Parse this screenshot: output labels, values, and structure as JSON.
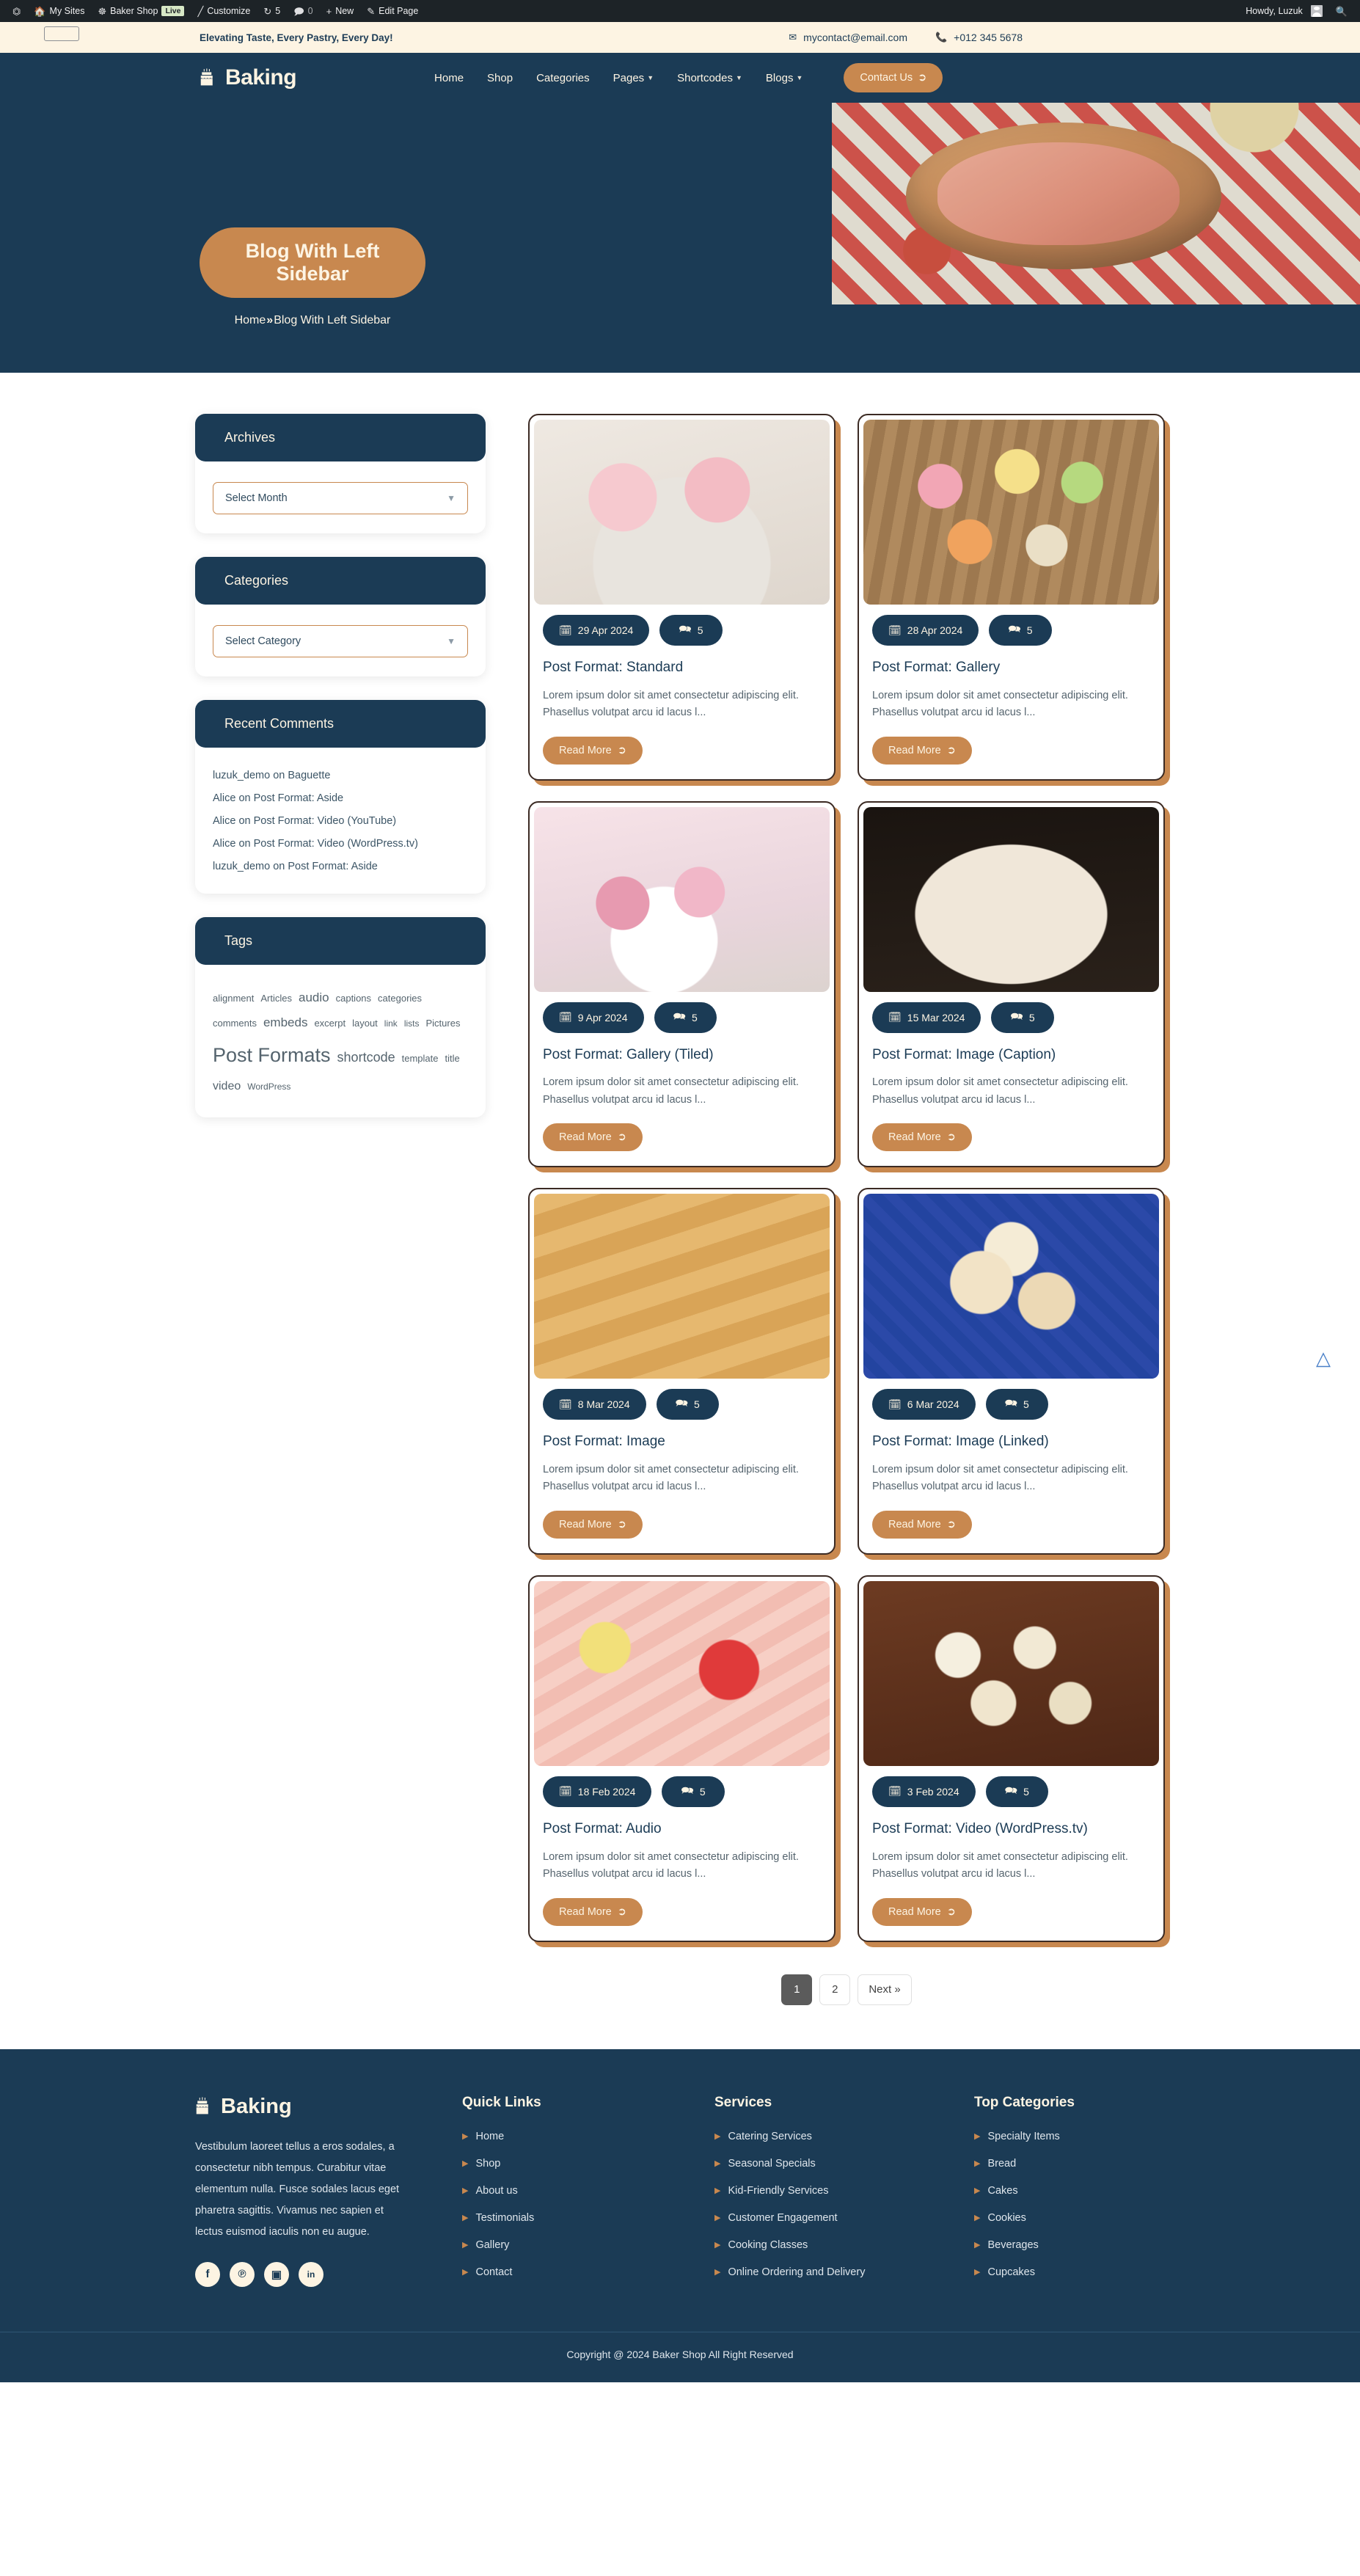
{
  "adminbar": {
    "logo_icon": "wordpress-icon",
    "items": [
      {
        "label": "My Sites",
        "icon": "sites-icon"
      },
      {
        "label": "Baker Shop",
        "icon": "dashboard-icon"
      },
      {
        "label": "Live",
        "icon": "live-badge"
      },
      {
        "label": "Customize",
        "icon": "paintbrush-icon"
      },
      {
        "label": "5",
        "icon": "updates-icon"
      },
      {
        "label": "0",
        "icon": "comment-bubble-icon"
      },
      {
        "label": "New",
        "icon": "plus-icon"
      },
      {
        "label": "Edit Page",
        "icon": "pencil-icon"
      }
    ],
    "howdy": "Howdy, Luzuk",
    "search_icon": "search-icon"
  },
  "topbar": {
    "tagline": "Elevating Taste, Every Pastry, Every Day!",
    "email": "mycontact@email.com",
    "email_icon": "envelope-icon",
    "phone": "+012 345 5678",
    "phone_icon": "phone-icon"
  },
  "header": {
    "brand": "Baking",
    "brand_icon": "cake-icon",
    "nav": [
      {
        "label": "Home",
        "has_dropdown": false
      },
      {
        "label": "Shop",
        "has_dropdown": false
      },
      {
        "label": "Categories",
        "has_dropdown": false
      },
      {
        "label": "Pages",
        "has_dropdown": true
      },
      {
        "label": "Shortcodes",
        "has_dropdown": true
      },
      {
        "label": "Blogs",
        "has_dropdown": true
      }
    ],
    "cta": "Contact Us",
    "cta_icon": "arrow-circle-right-icon"
  },
  "hero": {
    "title": "Blog With Left Sidebar",
    "breadcrumb_home": "Home",
    "breadcrumb_sep": "»",
    "breadcrumb_current": "Blog With Left Sidebar"
  },
  "sidebar": {
    "archives": {
      "title": "Archives",
      "select_value": "Select Month",
      "chevron_icon": "chevron-down-icon"
    },
    "categories": {
      "title": "Categories",
      "select_value": "Select Category",
      "chevron_icon": "chevron-down-icon"
    },
    "recent_comments": {
      "title": "Recent Comments",
      "items": [
        {
          "author": "luzuk_demo",
          "on": " on ",
          "post": "Baguette"
        },
        {
          "author": "Alice",
          "on": " on ",
          "post": "Post Format: Aside"
        },
        {
          "author": "Alice",
          "on": " on ",
          "post": "Post Format: Video (YouTube)"
        },
        {
          "author": "Alice",
          "on": " on ",
          "post": "Post Format: Video (WordPress.tv)"
        },
        {
          "author": "luzuk_demo",
          "on": " on ",
          "post": "Post Format: Aside"
        }
      ]
    },
    "tags": {
      "title": "Tags",
      "items": [
        {
          "label": "alignment",
          "size": 13
        },
        {
          "label": "Articles",
          "size": 13
        },
        {
          "label": "audio",
          "size": 17
        },
        {
          "label": "captions",
          "size": 13
        },
        {
          "label": "categories",
          "size": 13
        },
        {
          "label": "comments",
          "size": 13
        },
        {
          "label": "embeds",
          "size": 17
        },
        {
          "label": "excerpt",
          "size": 13
        },
        {
          "label": "layout",
          "size": 13
        },
        {
          "label": "link",
          "size": 12
        },
        {
          "label": "lists",
          "size": 12
        },
        {
          "label": "Pictures",
          "size": 13
        },
        {
          "label": "Post Formats",
          "size": 27
        },
        {
          "label": "shortcode",
          "size": 18
        },
        {
          "label": "template",
          "size": 13
        },
        {
          "label": "title",
          "size": 13
        },
        {
          "label": "video",
          "size": 16
        },
        {
          "label": "WordPress",
          "size": 12
        }
      ]
    }
  },
  "posts": {
    "date_icon": "calendar-icon",
    "comment_icon": "comment-bubble-icon",
    "read_more_label": "Read More",
    "read_more_icon": "arrow-circle-right-icon",
    "items": [
      {
        "date": "29 Apr 2024",
        "comments": "5",
        "title": "Post Format: Standard",
        "excerpt": "Lorem ipsum dolor sit amet consectetur adipiscing elit. Phasellus volutpat arcu id lacus l...",
        "media": "m1"
      },
      {
        "date": "28 Apr 2024",
        "comments": "5",
        "title": "Post Format: Gallery",
        "excerpt": "Lorem ipsum dolor sit amet consectetur adipiscing elit. Phasellus volutpat arcu id lacus l...",
        "media": "m2"
      },
      {
        "date": "9 Apr 2024",
        "comments": "5",
        "title": "Post Format: Gallery (Tiled)",
        "excerpt": "Lorem ipsum dolor sit amet consectetur adipiscing elit. Phasellus volutpat arcu id lacus l...",
        "media": "m3"
      },
      {
        "date": "15 Mar 2024",
        "comments": "5",
        "title": "Post Format: Image (Caption)",
        "excerpt": "Lorem ipsum dolor sit amet consectetur adipiscing elit. Phasellus volutpat arcu id lacus l...",
        "media": "m4"
      },
      {
        "date": "8 Mar 2024",
        "comments": "5",
        "title": "Post Format: Image",
        "excerpt": "Lorem ipsum dolor sit amet consectetur adipiscing elit. Phasellus volutpat arcu id lacus l...",
        "media": "m5"
      },
      {
        "date": "6 Mar 2024",
        "comments": "5",
        "title": "Post Format: Image (Linked)",
        "excerpt": "Lorem ipsum dolor sit amet consectetur adipiscing elit. Phasellus volutpat arcu id lacus l...",
        "media": "m6"
      },
      {
        "date": "18 Feb 2024",
        "comments": "5",
        "title": "Post Format: Audio",
        "excerpt": "Lorem ipsum dolor sit amet consectetur adipiscing elit. Phasellus volutpat arcu id lacus l...",
        "media": "m7"
      },
      {
        "date": "3 Feb 2024",
        "comments": "5",
        "title": "Post Format: Video (WordPress.tv)",
        "excerpt": "Lorem ipsum dolor sit amet consectetur adipiscing elit. Phasellus volutpat arcu id lacus l...",
        "media": "m8"
      }
    ]
  },
  "pagination": {
    "pages": [
      "1",
      "2"
    ],
    "current": "1",
    "next_label": "Next »"
  },
  "scroll_top_icon": "chevron-up-double-icon",
  "footer": {
    "brand": "Baking",
    "brand_icon": "cake-icon",
    "about": "Vestibulum laoreet tellus a eros sodales, a consectetur nibh tempus. Curabitur vitae elementum nulla. Fusce sodales lacus eget pharetra sagittis. Vivamus nec sapien et lectus euismod iaculis non eu augue.",
    "socials": [
      {
        "name": "facebook-icon",
        "glyph": "f"
      },
      {
        "name": "pinterest-icon",
        "glyph": "℗"
      },
      {
        "name": "instagram-icon",
        "glyph": "▣"
      },
      {
        "name": "linkedin-icon",
        "glyph": "in"
      }
    ],
    "columns": [
      {
        "title": "Quick Links",
        "items": [
          "Home",
          "Shop",
          "About us",
          "Testimonials",
          "Gallery",
          "Contact"
        ]
      },
      {
        "title": "Services",
        "items": [
          "Catering Services",
          "Seasonal Specials",
          "Kid-Friendly Services",
          "Customer Engagement",
          "Cooking Classes",
          "Online Ordering and Delivery"
        ]
      },
      {
        "title": "Top Categories",
        "items": [
          "Specialty Items",
          "Bread",
          "Cakes",
          "Cookies",
          "Beverages",
          "Cupcakes"
        ]
      }
    ],
    "copyright": "Copyright @ 2024 Baker Shop All Right Reserved"
  },
  "colors": {
    "navy": "#1b3b55",
    "accent": "#c8884f",
    "cream": "#fdf4e3"
  }
}
